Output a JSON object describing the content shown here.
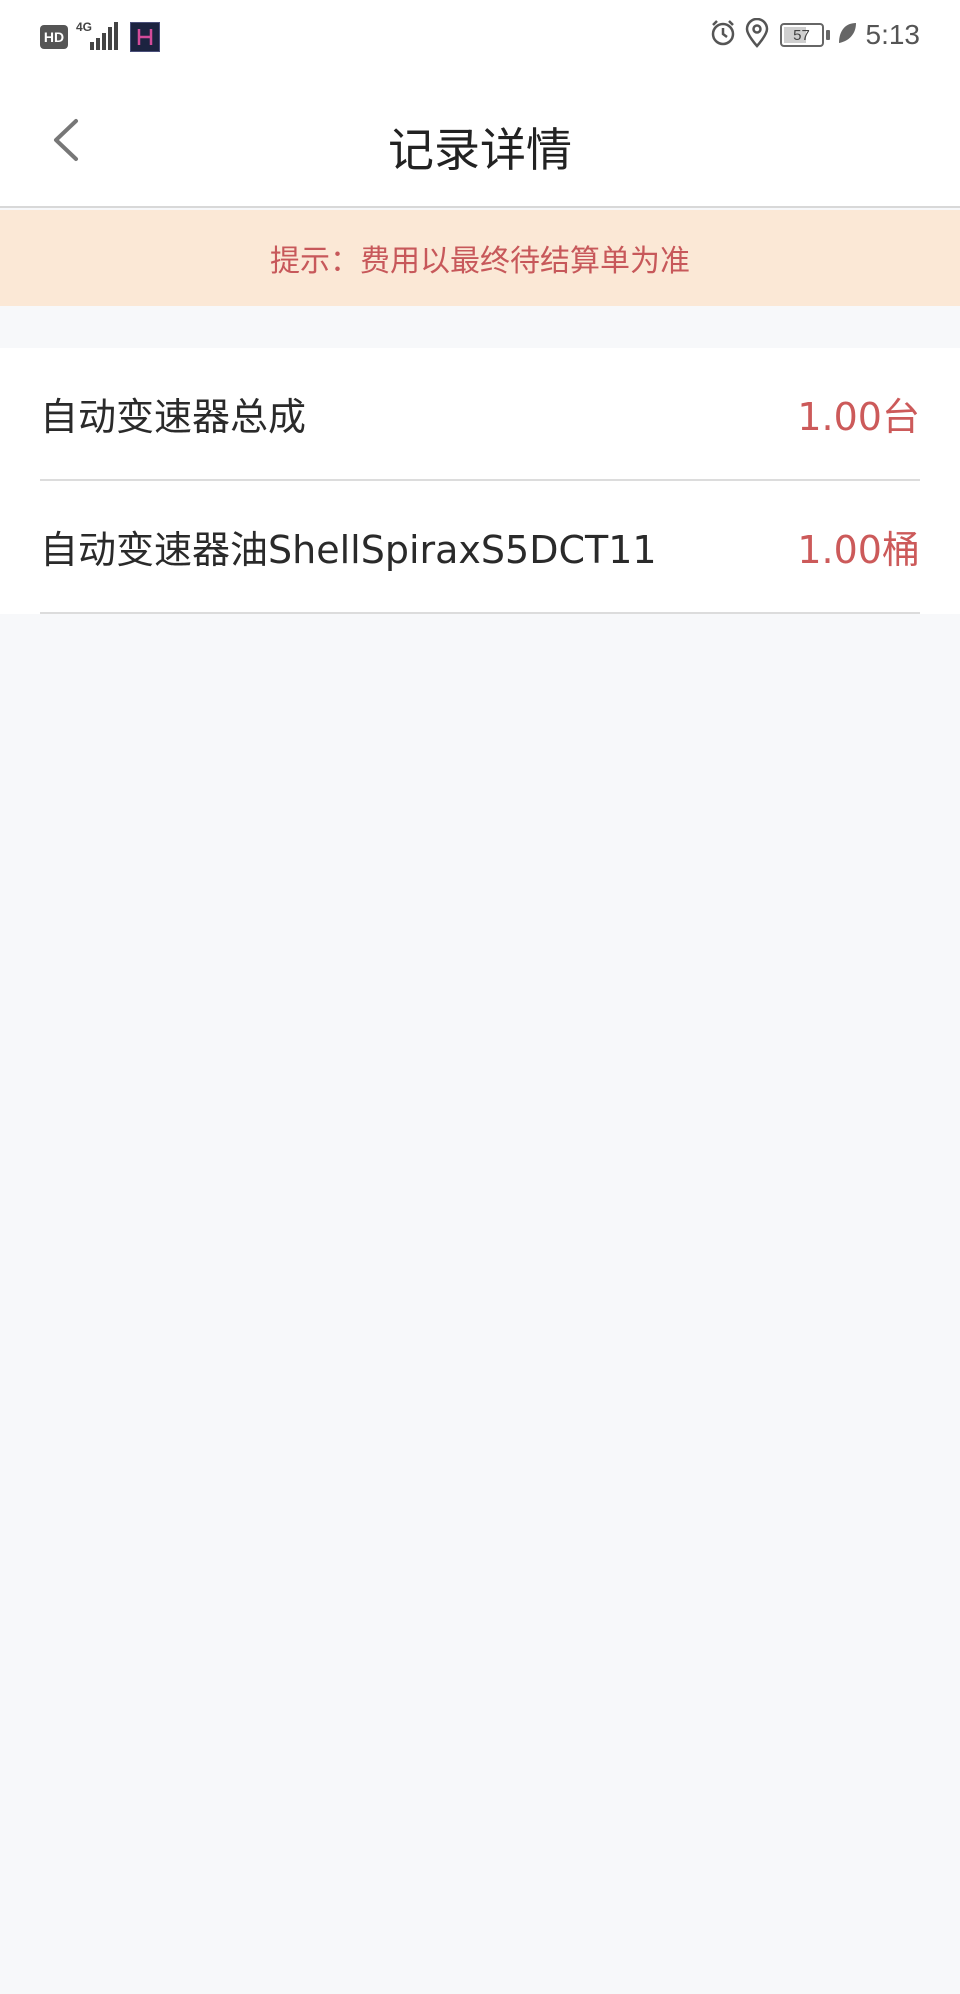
{
  "status_bar": {
    "hd_label": "HD",
    "network_label": "4G",
    "battery_level": "57",
    "time": "5:13"
  },
  "nav": {
    "title": "记录详情"
  },
  "notice": {
    "text": "提示：费用以最终待结算单为准"
  },
  "items": [
    {
      "name": "自动变速器总成",
      "quantity": "1.00台"
    },
    {
      "name": "自动变速器油ShellSpiraxS5DCT11",
      "quantity": "1.00桶"
    }
  ],
  "colors": {
    "accent_red": "#c7585a",
    "notice_bg": "#fbe8d6",
    "page_bg": "#f7f8fa"
  }
}
